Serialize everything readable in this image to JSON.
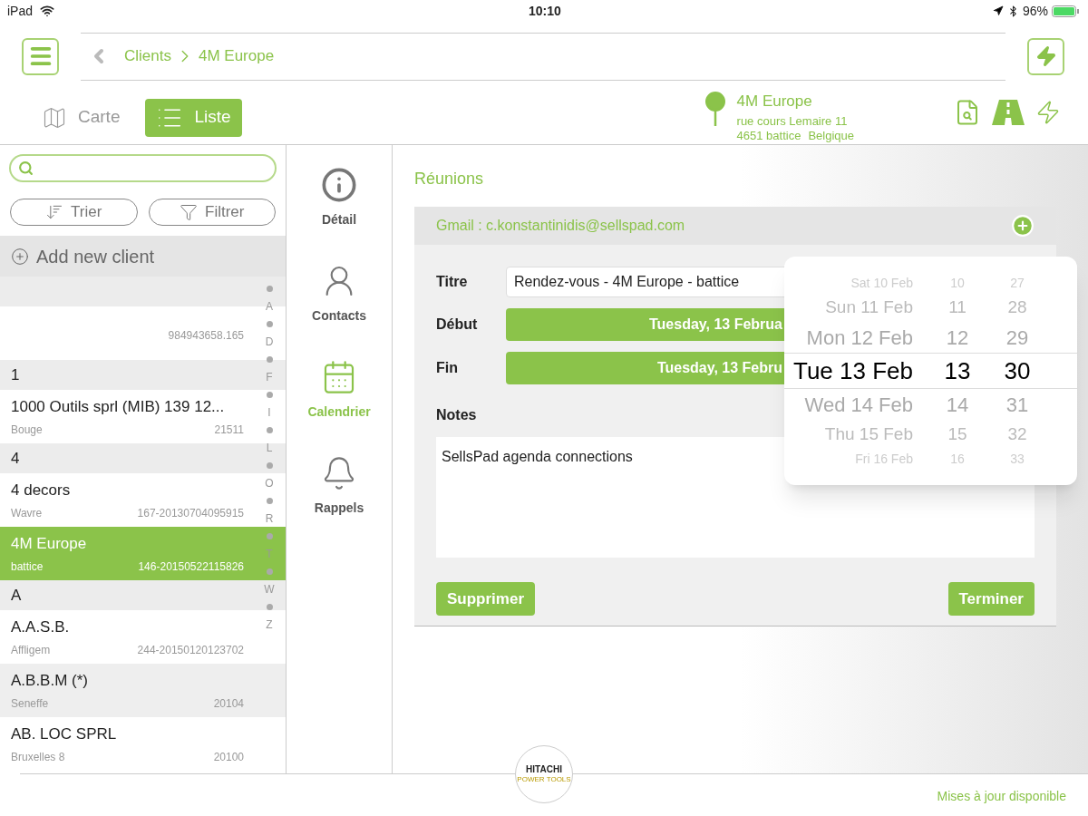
{
  "status_bar": {
    "device": "iPad",
    "time": "10:10",
    "battery": "96%"
  },
  "breadcrumb": [
    {
      "label": "Clients"
    },
    {
      "label": "4M Europe"
    }
  ],
  "view_tabs": [
    {
      "label": "Carte",
      "kind": "map",
      "selected": false
    },
    {
      "label": "Liste",
      "kind": "list",
      "selected": true
    }
  ],
  "client": {
    "name": "4M Europe",
    "street": "rue cours Lemaire 11",
    "city": "4651 battice",
    "country": "Belgique"
  },
  "sidebar": {
    "buttons": [
      {
        "label": "Trier",
        "kind": "sort"
      },
      {
        "label": "Filtrer",
        "kind": "filter"
      }
    ],
    "add_label": "Add new client",
    "items": [
      {
        "kind": "header"
      },
      {
        "kind": "client",
        "code": "984943658.165",
        "selected": false,
        "highlighted": false
      },
      {
        "kind": "header",
        "label": "1"
      },
      {
        "kind": "client",
        "name": "1000 Outils sprl (MIB) 139 12...",
        "city": "Bouge",
        "code": "21511",
        "selected": false,
        "highlighted": false
      },
      {
        "kind": "header",
        "label": "4"
      },
      {
        "kind": "client",
        "name": "4 decors",
        "city": "Wavre",
        "code": "167-20130704095915",
        "selected": false,
        "highlighted": false
      },
      {
        "kind": "client",
        "name": "4M Europe",
        "city": "battice",
        "code": "146-20150522115826",
        "selected": true,
        "highlighted": false
      },
      {
        "kind": "header",
        "label": "A"
      },
      {
        "kind": "client",
        "name": "A.A.S.B.",
        "city": "Affligem",
        "code": "244-20150120123702",
        "selected": false,
        "highlighted": false
      },
      {
        "kind": "client",
        "name": "A.B.B.M (*)",
        "city": "Seneffe",
        "code": "20104",
        "selected": false,
        "highlighted": true
      },
      {
        "kind": "client",
        "name": "AB. LOC SPRL",
        "city": "Bruxelles 8",
        "code": "20100",
        "selected": false,
        "highlighted": false
      }
    ],
    "index": [
      "A",
      "D",
      "F",
      "I",
      "L",
      "O",
      "R",
      "T",
      "W",
      "Z"
    ]
  },
  "nav": [
    {
      "label": "Détail",
      "kind": "info",
      "selected": false
    },
    {
      "label": "Contacts",
      "kind": "contacts",
      "selected": false
    },
    {
      "label": "Calendrier",
      "kind": "calendar",
      "selected": true
    },
    {
      "label": "Rappels",
      "kind": "bell",
      "selected": false
    }
  ],
  "section_title": "Réunions",
  "meeting": {
    "account": "Gmail : c.konstantinidis@sellspad.com",
    "fields": [
      {
        "label": "Titre",
        "kind": "text",
        "value": "Rendez-vous - 4M Europe - battice"
      },
      {
        "label": "Début",
        "kind": "date",
        "value": "Tuesday, 13 Februa"
      },
      {
        "label": "Fin",
        "kind": "date",
        "value": "Tuesday, 13 Febru"
      },
      {
        "label": "Notes",
        "kind": "notes",
        "value": "SellsPad agenda connections"
      }
    ],
    "delete_label": "Supprimer",
    "done_label": "Terminer"
  },
  "picker": [
    {
      "date": "Sat 10 Feb",
      "hour": "10",
      "minute": "27",
      "selected": false
    },
    {
      "date": "Sun 11 Feb",
      "hour": "11",
      "minute": "28",
      "selected": false
    },
    {
      "date": "Mon 12 Feb",
      "hour": "12",
      "minute": "29",
      "selected": false
    },
    {
      "date": "Tue 13 Feb",
      "hour": "13",
      "minute": "30",
      "selected": true
    },
    {
      "date": "Wed 14 Feb",
      "hour": "14",
      "minute": "31",
      "selected": false
    },
    {
      "date": "Thu 15 Feb",
      "hour": "15",
      "minute": "32",
      "selected": false
    },
    {
      "date": "Fri 16 Feb",
      "hour": "16",
      "minute": "33",
      "selected": false
    }
  ],
  "logo": {
    "name": "HITACHI",
    "tagline": "POWER TOOLS"
  },
  "footer": "Mises à jour disponible"
}
